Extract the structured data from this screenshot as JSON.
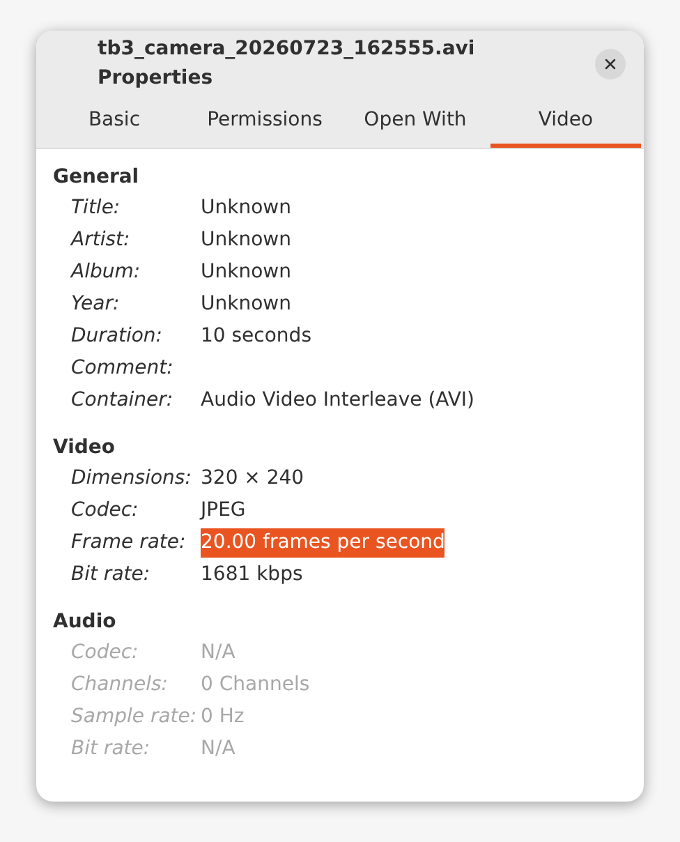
{
  "window": {
    "title": "tb3_camera_20260723_162555.avi Properties"
  },
  "tabs": [
    {
      "label": "Basic",
      "selected": false
    },
    {
      "label": "Permissions",
      "selected": false
    },
    {
      "label": "Open With",
      "selected": false
    },
    {
      "label": "Video",
      "selected": true
    }
  ],
  "sections": [
    {
      "title": "General",
      "disabled": false,
      "rows": [
        {
          "label": "Title:",
          "value": "Unknown",
          "selected": false
        },
        {
          "label": "Artist:",
          "value": "Unknown",
          "selected": false
        },
        {
          "label": "Album:",
          "value": "Unknown",
          "selected": false
        },
        {
          "label": "Year:",
          "value": "Unknown",
          "selected": false
        },
        {
          "label": "Duration:",
          "value": "10 seconds",
          "selected": false
        },
        {
          "label": "Comment:",
          "selected": false
        },
        {
          "label": "Container:",
          "value": "Audio Video Interleave (AVI)",
          "selected": false
        }
      ]
    },
    {
      "title": "Video",
      "disabled": false,
      "rows": [
        {
          "label": "Dimensions:",
          "value": "320 × 240",
          "selected": false
        },
        {
          "label": "Codec:",
          "value": "JPEG",
          "selected": false
        },
        {
          "label": "Frame rate:",
          "value": "20.00 frames per second",
          "selected": true
        },
        {
          "label": "Bit rate:",
          "value": "1681 kbps",
          "selected": false
        }
      ]
    },
    {
      "title": "Audio",
      "disabled": true,
      "rows": [
        {
          "label": "Codec:",
          "value": "N/A",
          "selected": false
        },
        {
          "label": "Channels:",
          "value": "0 Channels",
          "selected": false
        },
        {
          "label": "Sample rate:",
          "value": "0 Hz",
          "selected": false
        },
        {
          "label": "Bit rate:",
          "value": "N/A",
          "selected": false
        }
      ]
    }
  ]
}
